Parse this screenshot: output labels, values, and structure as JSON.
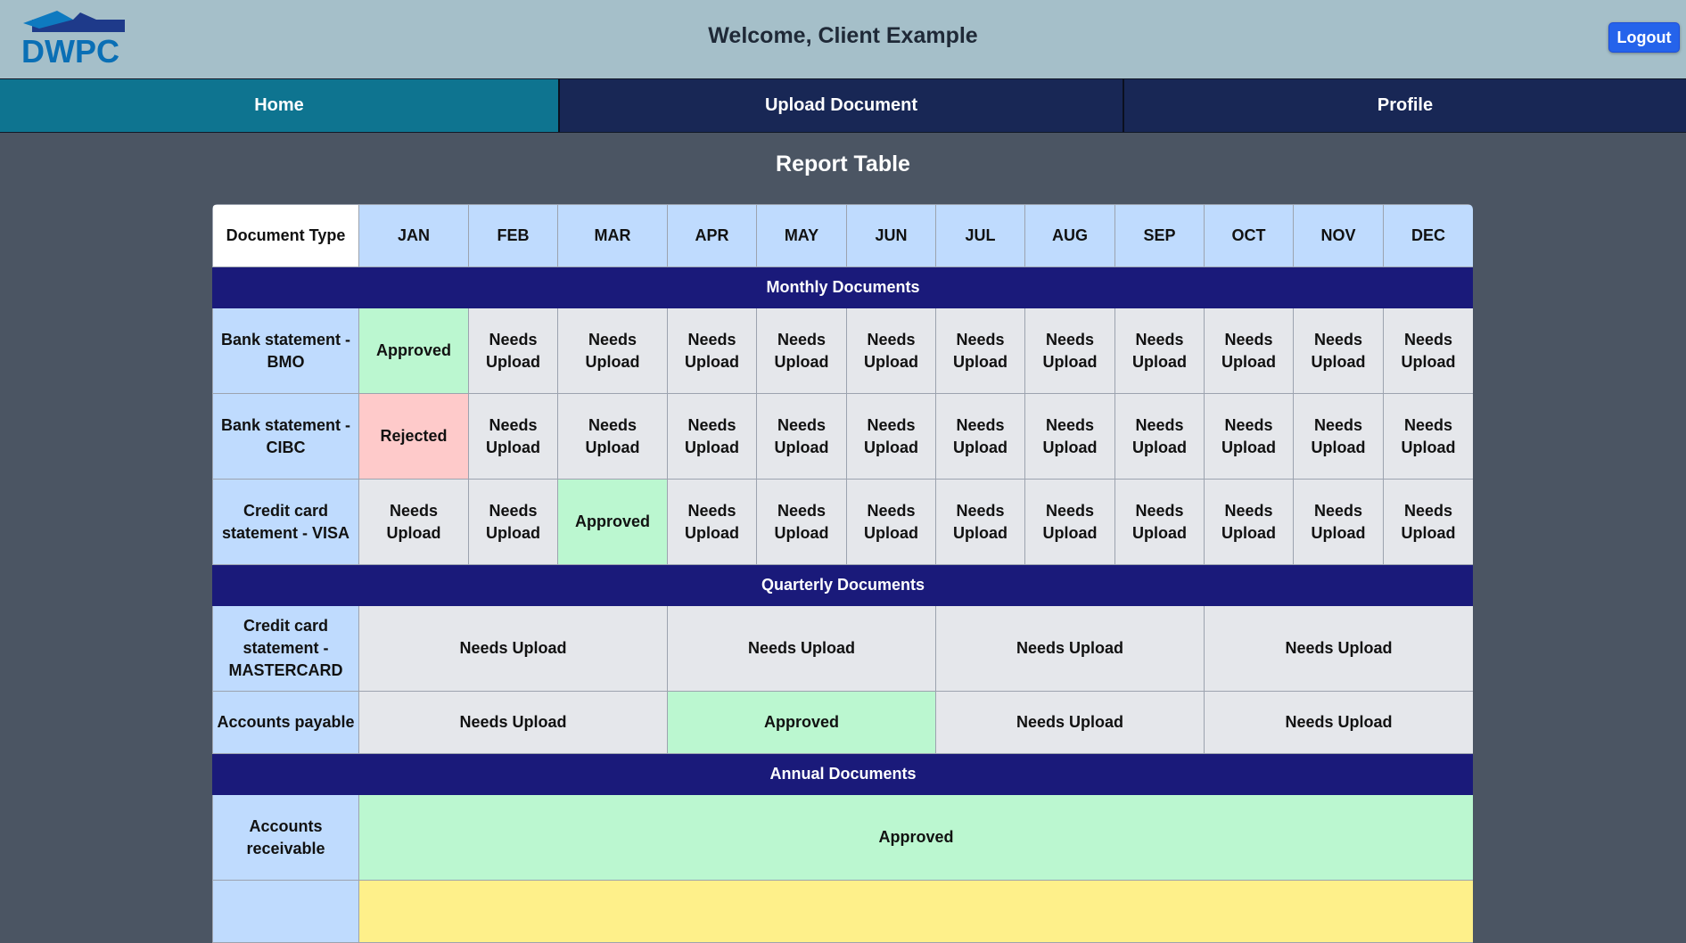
{
  "header": {
    "logo_text": "DWPC",
    "welcome": "Welcome, Client Example",
    "logout_label": "Logout"
  },
  "nav": {
    "tabs": [
      {
        "label": "Home",
        "active": true
      },
      {
        "label": "Upload Document",
        "active": false
      },
      {
        "label": "Profile",
        "active": false
      }
    ]
  },
  "page_title": "Report Table",
  "table": {
    "doc_header": "Document Type",
    "months": [
      "JAN",
      "FEB",
      "MAR",
      "APR",
      "MAY",
      "JUN",
      "JUL",
      "AUG",
      "SEP",
      "OCT",
      "NOV",
      "DEC"
    ],
    "sections": [
      {
        "title": "Monthly Documents",
        "rows": [
          {
            "doc": "Bank statement - BMO",
            "cells": [
              "Approved",
              "Needs Upload",
              "Needs Upload",
              "Needs Upload",
              "Needs Upload",
              "Needs Upload",
              "Needs Upload",
              "Needs Upload",
              "Needs Upload",
              "Needs Upload",
              "Needs Upload",
              "Needs Upload"
            ]
          },
          {
            "doc": "Bank statement - CIBC",
            "cells": [
              "Rejected",
              "Needs Upload",
              "Needs Upload",
              "Needs Upload",
              "Needs Upload",
              "Needs Upload",
              "Needs Upload",
              "Needs Upload",
              "Needs Upload",
              "Needs Upload",
              "Needs Upload",
              "Needs Upload"
            ]
          },
          {
            "doc": "Credit card statement - VISA",
            "cells": [
              "Needs Upload",
              "Needs Upload",
              "Approved",
              "Needs Upload",
              "Needs Upload",
              "Needs Upload",
              "Needs Upload",
              "Needs Upload",
              "Needs Upload",
              "Needs Upload",
              "Needs Upload",
              "Needs Upload"
            ]
          }
        ]
      },
      {
        "title": "Quarterly Documents",
        "rows": [
          {
            "doc": "Credit card statement - MASTERCARD",
            "cells": [
              "Needs Upload",
              "Needs Upload",
              "Needs Upload",
              "Needs Upload"
            ]
          },
          {
            "doc": "Accounts payable",
            "cells": [
              "Needs Upload",
              "Approved",
              "Needs Upload",
              "Needs Upload"
            ]
          }
        ]
      },
      {
        "title": "Annual Documents",
        "rows": [
          {
            "doc": "Accounts receivable",
            "cells": [
              "Approved"
            ]
          },
          {
            "doc": "",
            "cells": [
              ""
            ],
            "tone": "yellow"
          }
        ]
      }
    ]
  },
  "colors": {
    "header_bg": "#a5bfc9",
    "nav_active": "#0e7490",
    "nav_inactive": "#182755",
    "page_bg": "#4b5563",
    "section_bg": "#1a1a7a",
    "approved": "#bbf7d0",
    "rejected": "#fecaca",
    "needs_upload": "#e5e7eb",
    "doc_cell": "#bfdbfe"
  }
}
